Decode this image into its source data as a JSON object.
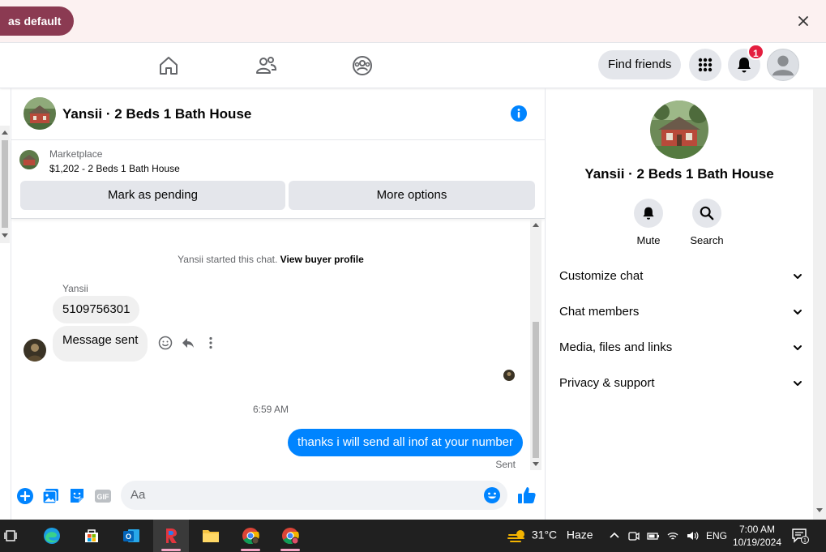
{
  "banner": {
    "button_label": "as default"
  },
  "nav": {
    "find_friends": "Find friends",
    "notification_count": "1"
  },
  "chat": {
    "title": "Yansii · 2 Beds 1 Bath House",
    "marketplace_label": "Marketplace",
    "listing": "$1,202 - 2 Beds 1 Bath House",
    "mark_pending": "Mark as pending",
    "more_options": "More options"
  },
  "messages": {
    "started_text": "Yansii started this chat.",
    "view_profile": "View buyer profile",
    "sender": "Yansii",
    "msg1": "5109756301",
    "msg2": "Message sent",
    "timestamp": "6:59 AM",
    "outgoing": "thanks i will send all inof at your number",
    "status": "Sent"
  },
  "composer": {
    "placeholder": "Aa",
    "gif": "GIF"
  },
  "panel": {
    "title": "Yansii · 2 Beds 1 Bath House",
    "mute": "Mute",
    "search": "Search",
    "rows": [
      "Customize chat",
      "Chat members",
      "Media, files and links",
      "Privacy & support"
    ]
  },
  "taskbar": {
    "temp": "31°C",
    "weather": "Haze",
    "lang": "ENG",
    "time": "7:00 AM",
    "date": "10/19/2024",
    "notif_count": "1"
  },
  "colors": {
    "accent": "#0084ff",
    "banner_button": "#8b3a52",
    "badge": "#e41e3f"
  }
}
